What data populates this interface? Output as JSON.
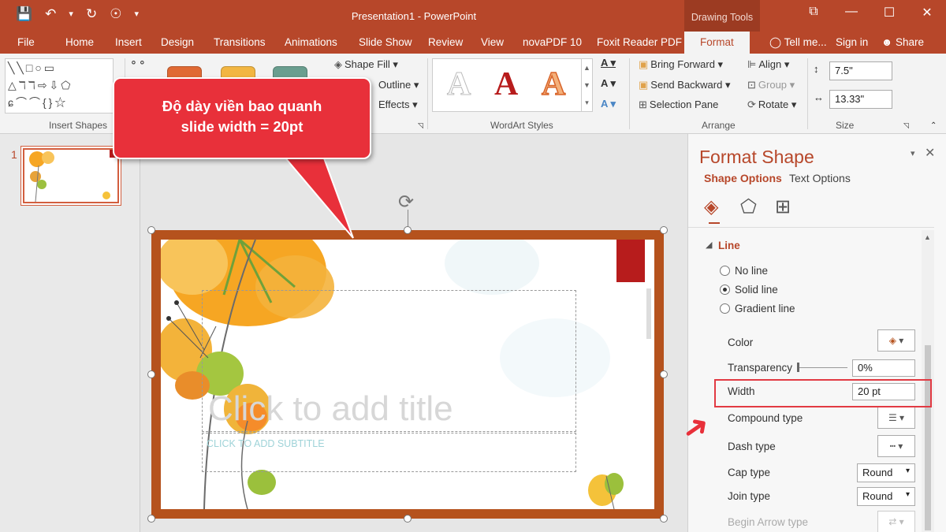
{
  "window": {
    "title": "Presentation1 - PowerPoint",
    "contextual_group": "Drawing Tools",
    "controls": [
      "⧉",
      "—",
      "☐",
      "✕"
    ]
  },
  "qat": [
    "💾",
    "↶",
    "▾",
    "↻",
    "☉",
    "▾"
  ],
  "tabs": {
    "file": "File",
    "home": "Home",
    "insert": "Insert",
    "design": "Design",
    "transitions": "Transitions",
    "animations": "Animations",
    "slideshow": "Slide Show",
    "review": "Review",
    "view": "View",
    "novapdf": "novaPDF 10",
    "foxit": "Foxit Reader PDF",
    "format": "Format",
    "tellme": "Tell me...",
    "signin": "Sign in",
    "share": "Share"
  },
  "ribbon": {
    "insert_shapes_label": "Insert Shapes",
    "shape_fill": "Shape Fill",
    "shape_outline": "Outline",
    "shape_effects": "Effects",
    "wordart_label": "WordArt Styles",
    "bring_forward": "Bring Forward",
    "send_backward": "Send Backward",
    "selection_pane": "Selection Pane",
    "align": "Align",
    "group": "Group",
    "rotate": "Rotate",
    "arrange_label": "Arrange",
    "height": "7.5\"",
    "width": "13.33\"",
    "size_label": "Size",
    "wordart_letters": [
      "A",
      "A",
      "A"
    ]
  },
  "thumbnail": {
    "number": "1"
  },
  "slide": {
    "title_placeholder": "Click to add title",
    "subtitle_placeholder": "CLICK TO ADD SUBTITLE"
  },
  "callout": {
    "line1": "Độ dày viền bao quanh",
    "line2": "slide width = 20pt"
  },
  "format_pane": {
    "title": "Format Shape",
    "tab_shape": "Shape Options",
    "tab_text": "Text Options",
    "section": "Line",
    "no_line": "No line",
    "solid_line": "Solid line",
    "gradient_line": "Gradient line",
    "color_label": "Color",
    "transparency_label": "Transparency",
    "transparency_value": "0%",
    "width_label": "Width",
    "width_value": "20 pt",
    "compound_label": "Compound type",
    "dash_label": "Dash type",
    "cap_label": "Cap type",
    "cap_value": "Round",
    "join_label": "Join type",
    "join_value": "Round",
    "begin_arrow_label": "Begin Arrow type"
  },
  "colors": {
    "accent": "#b7472a",
    "slide_border": "#b5521d",
    "callout": "#e8303a"
  }
}
